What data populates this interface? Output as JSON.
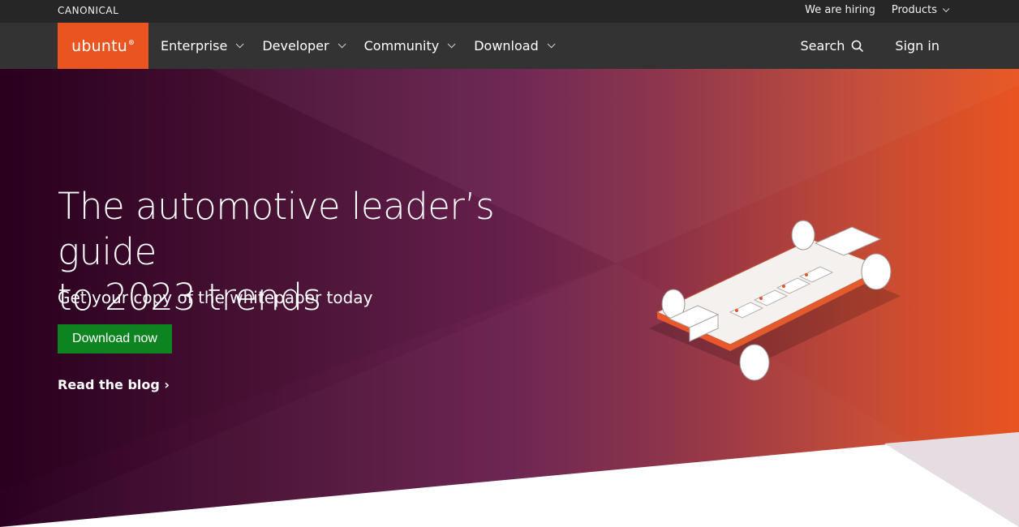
{
  "topbar": {
    "brand": "CANONICAL",
    "hiring": "We are hiring",
    "products": "Products"
  },
  "nav": {
    "brand": "ubuntu",
    "items": [
      {
        "label": "Enterprise"
      },
      {
        "label": "Developer"
      },
      {
        "label": "Community"
      },
      {
        "label": "Download"
      }
    ],
    "search": "Search",
    "signin": "Sign in"
  },
  "hero": {
    "title_line1": "The automotive leader’s guide",
    "title_line2": "to 2023 trends",
    "subtitle": "Get your copy of the whitepaper today",
    "cta": "Download now",
    "blog_link": "Read the blog ›"
  },
  "colors": {
    "ubuntu_orange": "#e95420",
    "cta_green": "#0e8420",
    "topbar_bg": "#262626",
    "nav_bg": "#333333"
  }
}
